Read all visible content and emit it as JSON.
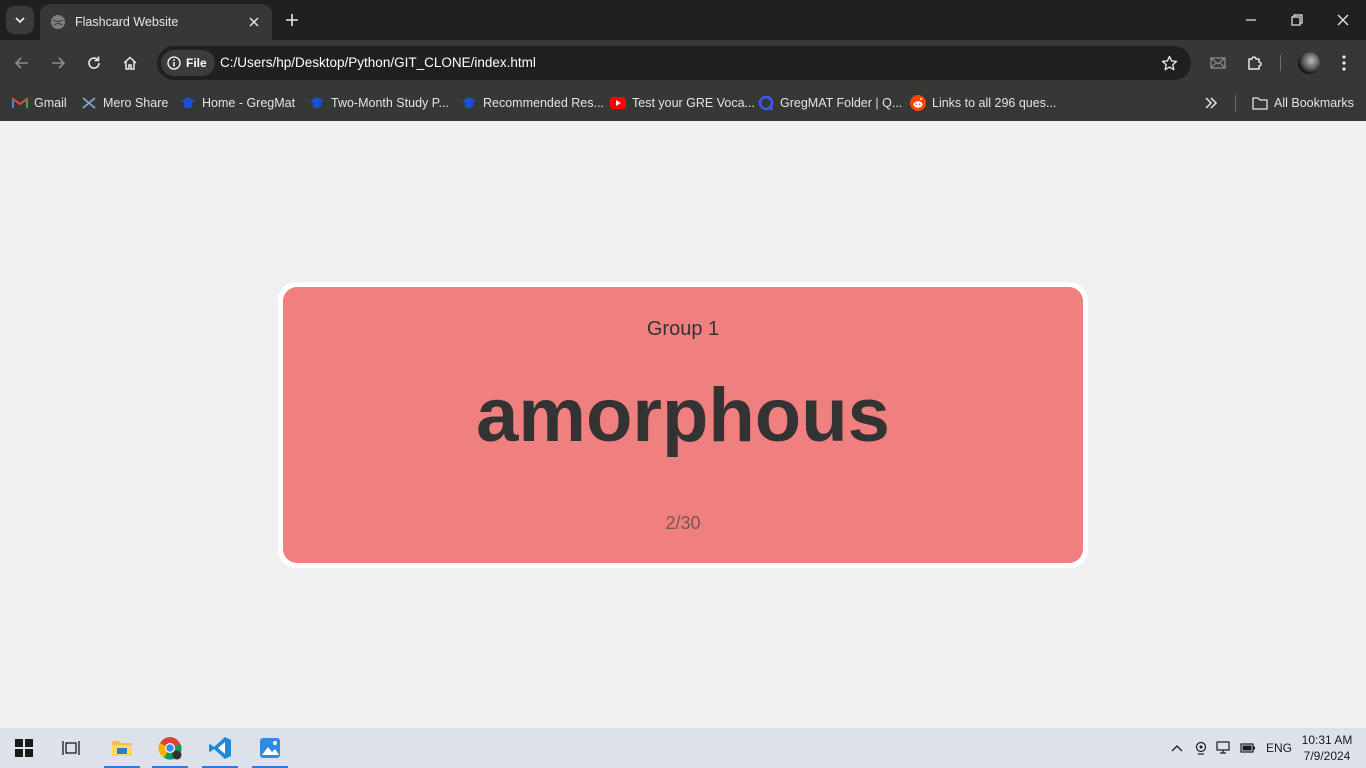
{
  "browser": {
    "tab": {
      "title": "Flashcard Website"
    },
    "site_chip": "File",
    "url": "C:/Users/hp/Desktop/Python/GIT_CLONE/index.html",
    "bookmarks": [
      {
        "label": "Gmail",
        "icon": "gmail-icon"
      },
      {
        "label": "Mero Share",
        "icon": "mero-share-icon"
      },
      {
        "label": "Home - GregMat",
        "icon": "gregmat-icon"
      },
      {
        "label": "Two-Month Study P...",
        "icon": "gregmat-icon"
      },
      {
        "label": "Recommended Res...",
        "icon": "gregmat-icon"
      },
      {
        "label": "Test your GRE Voca...",
        "icon": "youtube-icon"
      },
      {
        "label": "GregMAT Folder | Q...",
        "icon": "quizlet-icon"
      },
      {
        "label": "Links to all 296 ques...",
        "icon": "reddit-icon"
      }
    ],
    "all_bookmarks": "All Bookmarks"
  },
  "card": {
    "group": "Group 1",
    "word": "amorphous",
    "count": "2/30",
    "background_color": "#f08080"
  },
  "taskbar": {
    "apps": [
      "start-icon",
      "task-view-icon",
      "file-explorer-icon",
      "chrome-icon",
      "vscode-icon",
      "photos-icon"
    ],
    "language": "ENG",
    "time": "10:31 AM",
    "date": "7/9/2024"
  }
}
